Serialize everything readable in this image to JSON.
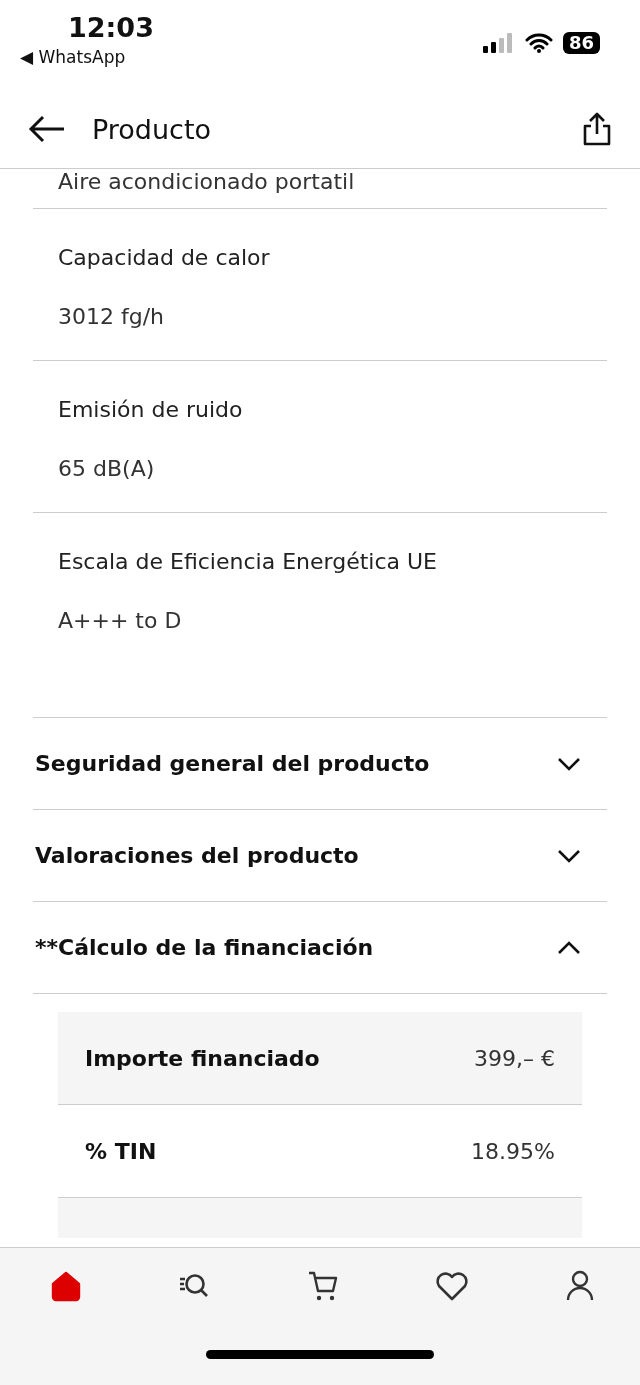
{
  "status_bar": {
    "time": "12:03",
    "back_app": "◀ WhatsApp",
    "battery": "86"
  },
  "header": {
    "title": "Producto"
  },
  "specs": [
    {
      "value": "Aire acondicionado portatil"
    },
    {
      "label": "Capacidad de calor",
      "value": "3012 fg/h"
    },
    {
      "label": "Emisión de ruido",
      "value": "65 dB(A)"
    },
    {
      "label": "Escala de Eficiencia Energética UE",
      "value": "A+++ to D"
    }
  ],
  "sections": [
    {
      "title": "Seguridad general del producto",
      "expanded": false
    },
    {
      "title": "Valoraciones del producto",
      "expanded": false
    },
    {
      "title": "**Cálculo de la financiación",
      "expanded": true
    }
  ],
  "finance_rows": [
    {
      "label": "Importe financiado",
      "value": "399,– €"
    },
    {
      "label": "% TIN",
      "value": "18.95%"
    }
  ],
  "nav": [
    {
      "kind": "home",
      "selected": true
    },
    {
      "kind": "search",
      "selected": false
    },
    {
      "kind": "cart",
      "selected": false
    },
    {
      "kind": "favorites",
      "selected": false
    },
    {
      "kind": "profile",
      "selected": false
    }
  ]
}
